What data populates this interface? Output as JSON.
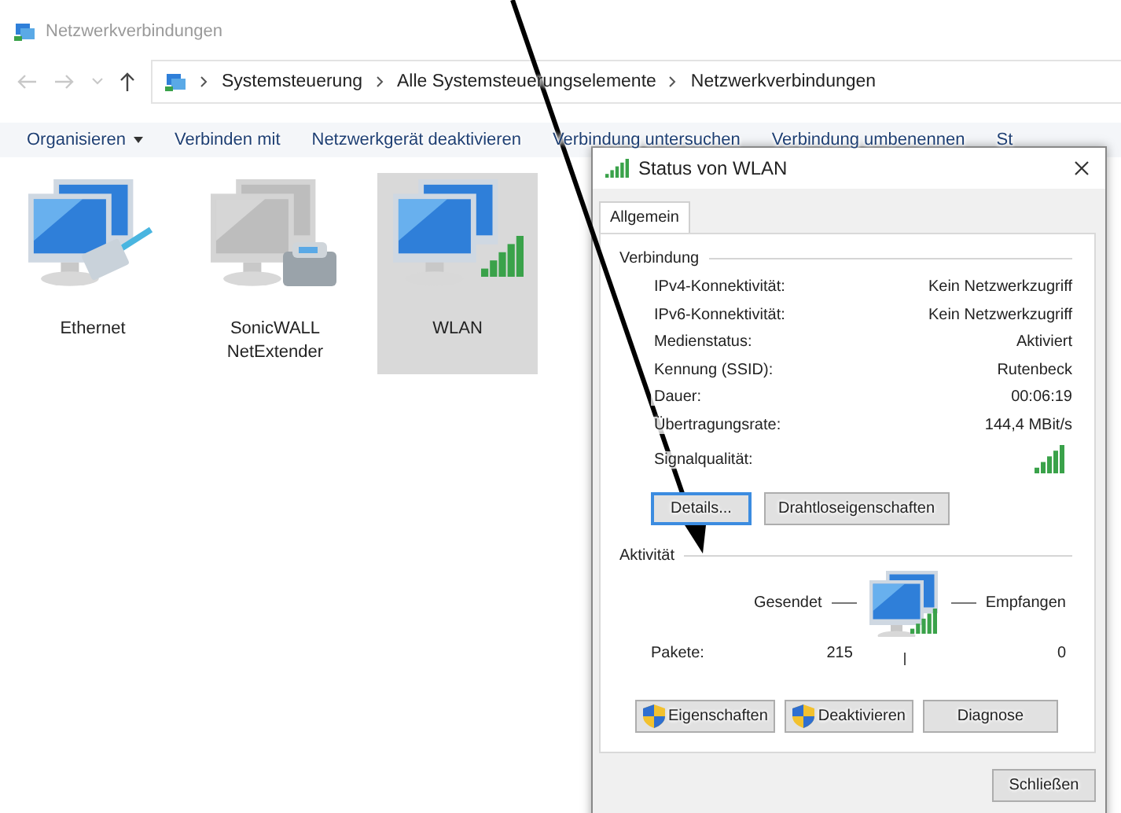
{
  "window": {
    "title": "Netzwerkverbindungen"
  },
  "address_bar": {
    "path": [
      "Systemsteuerung",
      "Alle Systemsteuerungselemente",
      "Netzwerkverbindungen"
    ]
  },
  "toolbar": [
    {
      "label": "Organisieren",
      "dropdown": true
    },
    {
      "label": "Verbinden mit",
      "dropdown": false
    },
    {
      "label": "Netzwerkgerät deaktivieren",
      "dropdown": false
    },
    {
      "label": "Verbindung untersuchen",
      "dropdown": false
    },
    {
      "label": "Verbindung umbenennen",
      "dropdown": false
    },
    {
      "label": "St",
      "dropdown": false
    }
  ],
  "connections": [
    {
      "name": "Ethernet",
      "kind": "ethernet",
      "selected": false
    },
    {
      "name": "SonicWALL NetExtender",
      "kind": "phone",
      "selected": false
    },
    {
      "name": "WLAN",
      "kind": "wireless",
      "selected": true
    }
  ],
  "dialog": {
    "title": "Status von WLAN",
    "tabs": [
      {
        "label": "Allgemein",
        "selected": true
      }
    ],
    "connection_group": "Verbindung",
    "details": [
      {
        "kind": "text",
        "label": "IPv4-Konnektivität:",
        "value": "Kein Netzwerkzugriff"
      },
      {
        "kind": "text",
        "label": "IPv6-Konnektivität:",
        "value": "Kein Netzwerkzugriff"
      },
      {
        "kind": "text",
        "label": "Medienstatus:",
        "value": "Aktiviert"
      },
      {
        "kind": "text",
        "label": "Kennung (SSID):",
        "value": "Rutenbeck"
      },
      {
        "kind": "text",
        "label": "Dauer:",
        "value": "00:06:19"
      },
      {
        "kind": "text",
        "label": "Übertragungsrate:",
        "value": "144,4 MBit/s"
      },
      {
        "kind": "signal",
        "label": "Signalqualität:"
      }
    ],
    "connection_buttons": [
      {
        "label": "Details...",
        "focused": true
      },
      {
        "label": "Drahtloseigenschaften",
        "focused": false
      }
    ],
    "activity_group": "Aktivität",
    "sent_label": "Gesendet",
    "received_label": "Empfangen",
    "packets": {
      "label": "Pakete:",
      "sent": "215",
      "received": "0"
    },
    "action_buttons": [
      {
        "label": "Eigenschaften",
        "shield": true
      },
      {
        "label": "Deaktivieren",
        "shield": true
      },
      {
        "label": "Diagnose",
        "shield": false
      }
    ],
    "close_button": "Schließen"
  }
}
